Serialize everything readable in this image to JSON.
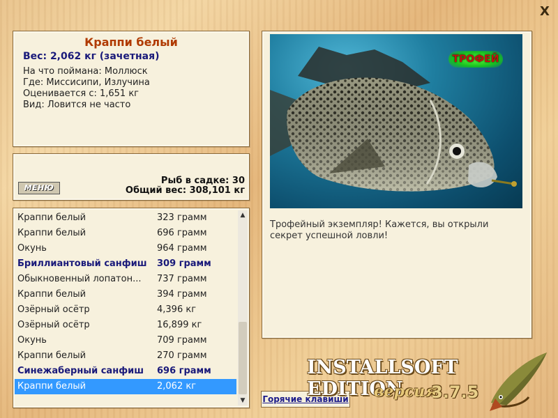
{
  "window": {
    "close_glyph": "X"
  },
  "fish_info": {
    "name": "Краппи белый",
    "weight_line": "Вес: 2,062 кг (зачетная)",
    "bait": "На что поймана: Моллюск",
    "location": "Где: Миссисипи, Излучина",
    "valued_from": "Оценивается с: 1,651 кг",
    "rarity": "Вид: Ловится не часто"
  },
  "stats": {
    "menu_label": "МЕНЮ",
    "fish_count": "Рыб в садке: 30",
    "total_weight": "Общий вес: 308,101 кг"
  },
  "catch_list": {
    "rows": [
      {
        "name": "Краппи белый",
        "weight": "323 грамм",
        "style": "normal"
      },
      {
        "name": "Краппи белый",
        "weight": "696 грамм",
        "style": "normal"
      },
      {
        "name": "Окунь",
        "weight": "964 грамм",
        "style": "normal"
      },
      {
        "name": "Бриллиантовый санфиш",
        "weight": "309 грамм",
        "style": "bold"
      },
      {
        "name": "Обыкновенный лопатон...",
        "weight": "737 грамм",
        "style": "normal"
      },
      {
        "name": "Краппи белый",
        "weight": "394 грамм",
        "style": "normal"
      },
      {
        "name": "Озёрный осётр",
        "weight": "4,396 кг",
        "style": "normal"
      },
      {
        "name": "Озёрный осётр",
        "weight": "16,899 кг",
        "style": "normal"
      },
      {
        "name": "Окунь",
        "weight": "709 грамм",
        "style": "normal"
      },
      {
        "name": "Краппи белый",
        "weight": "270 грамм",
        "style": "normal"
      },
      {
        "name": "Синежаберный санфиш",
        "weight": "696 грамм",
        "style": "bold"
      },
      {
        "name": "Краппи белый",
        "weight": "2,062 кг",
        "style": "selected"
      }
    ],
    "scroll": {
      "up_icon": "chevron-up-icon",
      "down_icon": "chevron-down-icon"
    }
  },
  "picture": {
    "trophy_badge": "ТРОФЕЙ",
    "caption": "Трофейный экземпляр! Кажется, вы открыли секрет успешной ловли!"
  },
  "footer": {
    "hotkeys_label": "Горячие клавиши",
    "brand": "INSTALLSOFT EDITION",
    "version_word": "версия",
    "version_number": "3.7.5"
  },
  "colors": {
    "selection": "#3399ff",
    "name_orange": "#b03a00",
    "bold_blue": "#1a1a7a"
  }
}
